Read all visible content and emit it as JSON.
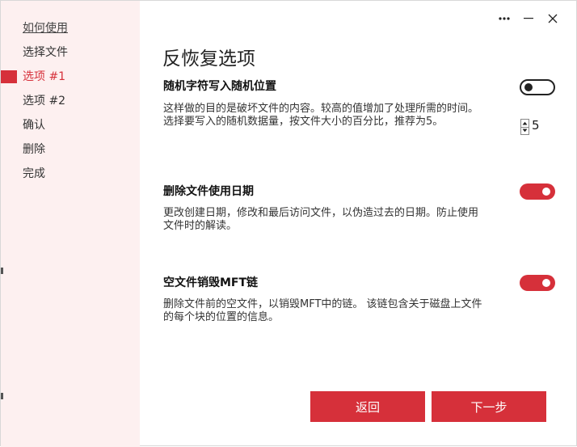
{
  "sidebar": {
    "items": [
      {
        "label": "如何使用"
      },
      {
        "label": "选择文件"
      },
      {
        "label": "选项 #1"
      },
      {
        "label": "选项 #2"
      },
      {
        "label": "确认"
      },
      {
        "label": "删除"
      },
      {
        "label": "完成"
      }
    ],
    "active_index": 2
  },
  "main": {
    "title": "反恢复选项",
    "options": [
      {
        "title": "随机字符写入随机位置",
        "description": "这样做的目的是破坏文件的内容。较高的值增加了处理所需的时间。 选择要写入的随机数据量，按文件大小的百分比，推荐为5。",
        "enabled": false,
        "spinner_value": "5"
      },
      {
        "title": "删除文件使用日期",
        "description": "更改创建日期，修改和最后访问文件，以伪造过去的日期。防止使用文件时的解读。",
        "enabled": true
      },
      {
        "title": "空文件销毁MFT链",
        "description": "删除文件前的空文件，以销毁MFT中的链。 该链包含关于磁盘上文件的每个块的位置的信息。",
        "enabled": true
      }
    ],
    "back_label": "返回",
    "next_label": "下一步"
  },
  "colors": {
    "accent": "#d6303a",
    "sidebar_bg": "#fdf0f0"
  },
  "icons": {
    "more": "more-horizontal-icon",
    "minimize": "minimize-icon",
    "close": "close-icon"
  }
}
